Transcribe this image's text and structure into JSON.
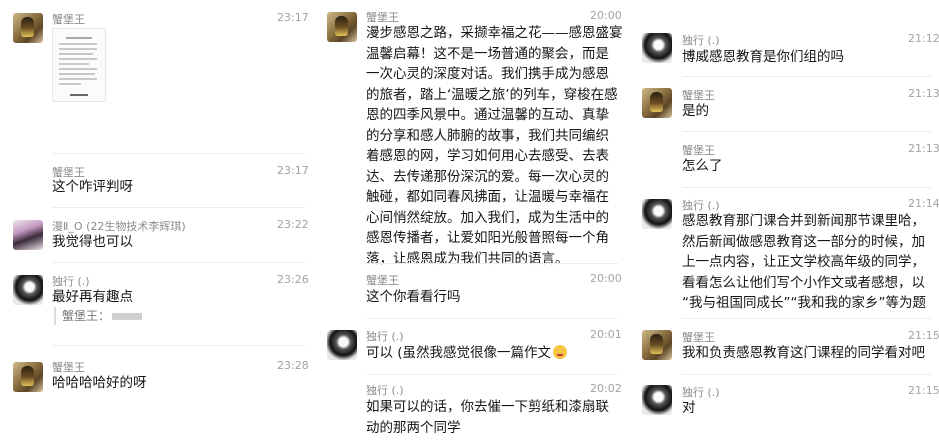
{
  "col1": {
    "messages": [
      {
        "name": "蟹堡王",
        "time": "23:17",
        "text": "",
        "attachment": "document-thumbnail"
      },
      {
        "name": "蟹堡王",
        "time": "23:17",
        "text": "这个咋评判呀"
      },
      {
        "name": "漫Ⅱ_O (22生物技术李辉琪)",
        "time": "23:22",
        "text": "我觉得也可以"
      },
      {
        "name": "独行 (.)",
        "time": "23:26",
        "text": "最好再有趣点",
        "quote": "蟹堡王："
      },
      {
        "name": "蟹堡王",
        "time": "23:28",
        "text": "哈哈哈哈好的呀"
      }
    ]
  },
  "col2": {
    "messages": [
      {
        "name": "蟹堡王",
        "time": "20:00",
        "lines": [
          "漫步感恩之路，采撷幸福之花——感恩盛宴",
          "温馨启幕！这不是一场普通的聚会，而是",
          "一次心灵的深度对话。我们携手成为感恩",
          "的旅者，踏上‘温暖之旅’的列车，穿梭在感",
          "恩的四季风景中。通过温馨的互动、真挚",
          "的分享和感人肺腑的故事，我们共同编织",
          "着感恩的网，学习如何用心去感受、去表",
          "达、去传递那份深沉的爱。每一次心灵的",
          "触碰，都如同春风拂面，让温暖与幸福在",
          "心间悄然绽放。加入我们，成为生活中的",
          "感恩传播者，让爱如阳光般普照每一个角",
          "落，让感恩成为我们共同的语言。"
        ]
      },
      {
        "name": "蟹堡王",
        "time": "20:00",
        "text": "这个你看看行吗"
      },
      {
        "name": "独行 (.)",
        "time": "20:01",
        "text": "可以 (虽然我感觉很像一篇作文",
        "emoji": "blush-emoji"
      },
      {
        "name": "独行 (.)",
        "time": "20:02",
        "lines": [
          "如果可以的话，你去催一下剪纸和漆扇联",
          "动的那两个同学"
        ]
      }
    ]
  },
  "col3": {
    "messages": [
      {
        "name": "独行 (.)",
        "time": "21:12",
        "text": "博威感恩教育是你们组的吗"
      },
      {
        "name": "蟹堡王",
        "time": "21:13",
        "text": "是的"
      },
      {
        "name": "蟹堡王",
        "time": "21:13",
        "text": "怎么了"
      },
      {
        "name": "独行 (.)",
        "time": "21:14",
        "lines": [
          "感恩教育那门课合并到新闻那节课里哈，",
          "然后新闻做感恩教育这一部分的时候，加",
          "上一点内容，让正文学校高年级的同学，",
          "看看怎么让他们写个小作文或者感想，以",
          "“我与祖国同成长”“我和我的家乡”等为题"
        ]
      },
      {
        "name": "蟹堡王",
        "time": "21:15",
        "text": "我和负责感恩教育这门课程的同学看对吧"
      },
      {
        "name": "独行 (.)",
        "time": "21:15",
        "text": "对"
      }
    ]
  }
}
